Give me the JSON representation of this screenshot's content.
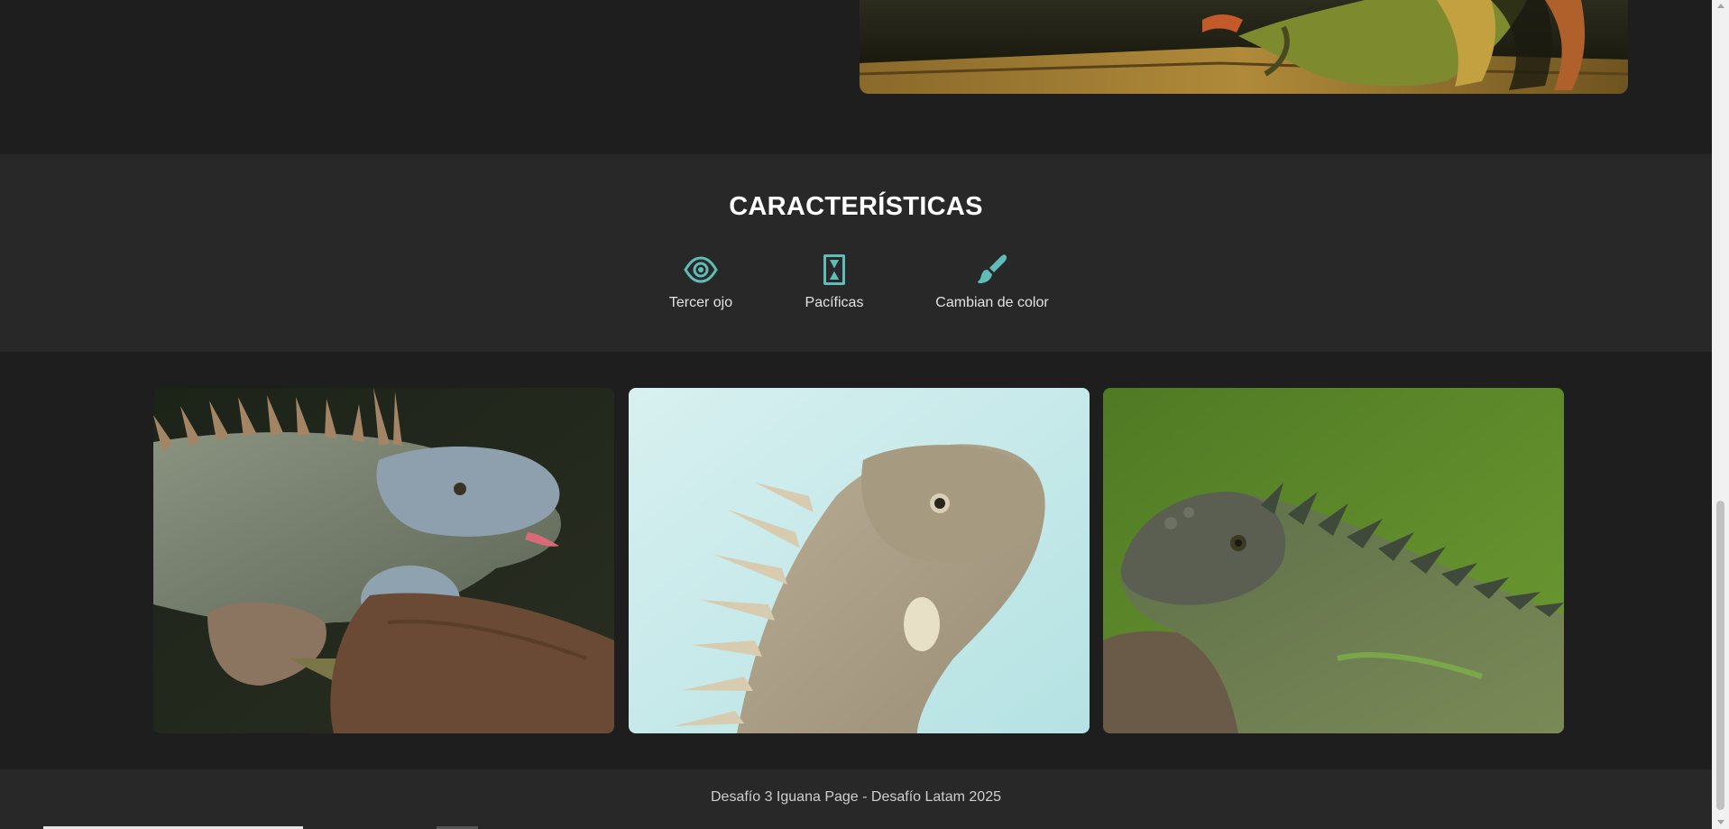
{
  "features": {
    "title": "CARACTERÍSTICAS",
    "items": [
      {
        "label": "Tercer ojo",
        "icon": "eye-icon"
      },
      {
        "label": "Pacíficas",
        "icon": "hourglass-icon"
      },
      {
        "label": "Cambian de color",
        "icon": "paintbrush-icon"
      }
    ],
    "icon_color": "#5fbcb7"
  },
  "gallery": {
    "photos": [
      "iguana-photo",
      "iguana-photo",
      "iguana-photo"
    ]
  },
  "footer": {
    "text": "Desafío 3 Iguana Page - Desafío Latam 2025"
  },
  "colors": {
    "background": "#1e1e1e",
    "band": "#282828",
    "accent": "#5fbcb7"
  }
}
